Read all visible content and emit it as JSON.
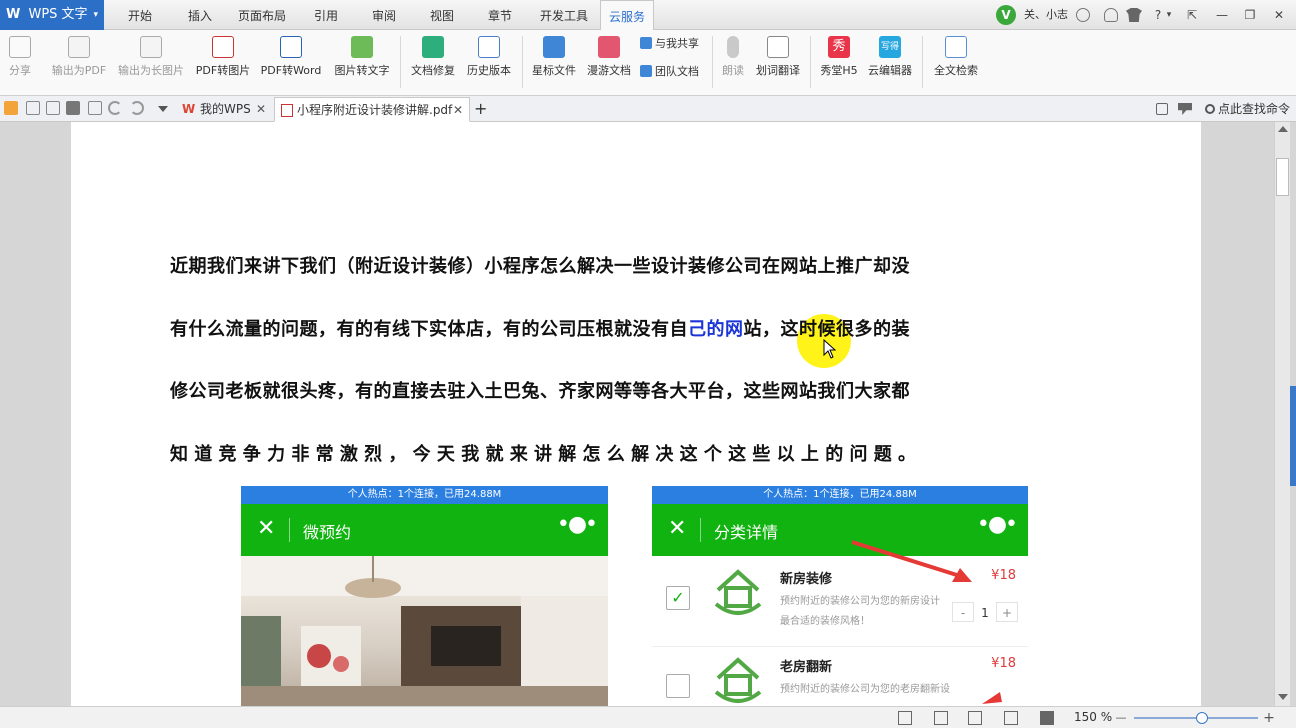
{
  "app": {
    "logo": "W",
    "title": "WPS 文字",
    "caret": "▾"
  },
  "menu_tabs": [
    "开始",
    "插入",
    "页面布局",
    "引用",
    "审阅",
    "视图",
    "章节",
    "开发工具",
    "云服务"
  ],
  "active_menu_tab": "云服务",
  "user": {
    "name": "关、小志",
    "badge": "V"
  },
  "window_controls": {
    "restore": "⇱",
    "minimize": "—",
    "maximize": "❐",
    "close": "✕",
    "help": "?",
    "caret": "▾"
  },
  "ribbon": {
    "share": "分享",
    "export_pdf": "输出为PDF",
    "export_long_image": "输出为长图片",
    "pdf_to_image": "PDF转图片",
    "pdf_to_word": "PDF转Word",
    "image_to_text": "图片转文字",
    "doc_repair": "文档修复",
    "history": "历史版本",
    "starred": "星标文件",
    "roaming": "漫游文档",
    "shared_with_me": "与我共享",
    "team_docs": "团队文档",
    "read_aloud": "朗读",
    "translate": "划词翻译",
    "xiutang": "秀堂H5",
    "cloud_editor": "云编辑器",
    "fulltext_search": "全文检索",
    "xiu_glyph": "秀",
    "editor_glyph": "写得"
  },
  "tabs": [
    {
      "label": "我的WPS",
      "close": "✕"
    },
    {
      "label": "小程序附近设计装修讲解.pdf",
      "close": "✕"
    }
  ],
  "new_tab": "+",
  "command_search": "点此查找命令",
  "document": {
    "lines": [
      {
        "text": "近期我们来讲下我们（附近设计装修）小程序怎么解决一些设计装修公司在网站上推广却没"
      },
      {
        "before": "有什么流量的问题，有的有线下实体店，有的公司压根就没有自",
        "highlight": "己的网",
        "after": "站，这时候很多的装"
      },
      {
        "text": "修公司老板就很头疼，有的直接去驻入土巴兔、齐家网等等各大平台，这些网站我们大家都"
      },
      {
        "text": "知 道 竞 争 力 非 常 激 烈 ， 今 天 我 就 来 讲 解 怎 么 解 决 这 个 这 些 以 上 的 问 题 。"
      }
    ]
  },
  "phone_left": {
    "status": "个人热点：1个连接，已用24.88M",
    "close": "✕",
    "title": "微预约",
    "more": "•●•"
  },
  "phone_right": {
    "status": "个人热点：1个连接，已用24.88M",
    "close": "✕",
    "title": "分类详情",
    "more": "•●•",
    "items": [
      {
        "name": "新房装修",
        "price": "¥18",
        "desc": "预约附近的装修公司为您的新房设计最合适的装修风格！",
        "checked": "✓",
        "qty": "1"
      },
      {
        "name": "老房翻新",
        "price": "¥18",
        "desc": "预约附近的装修公司为您的老房翻新设",
        "checked": ""
      }
    ],
    "minus": "-",
    "plus": "+"
  },
  "statusbar": {
    "zoom": "150 %",
    "minus": "—",
    "plus": "+"
  },
  "colors": {
    "wps_blue": "#2c6fc6",
    "wechat_green": "#10b30f",
    "status_blue": "#2b7fe0",
    "highlight": "#fff200",
    "price_red": "#e03b3b",
    "link_blue": "#1c35d6"
  }
}
